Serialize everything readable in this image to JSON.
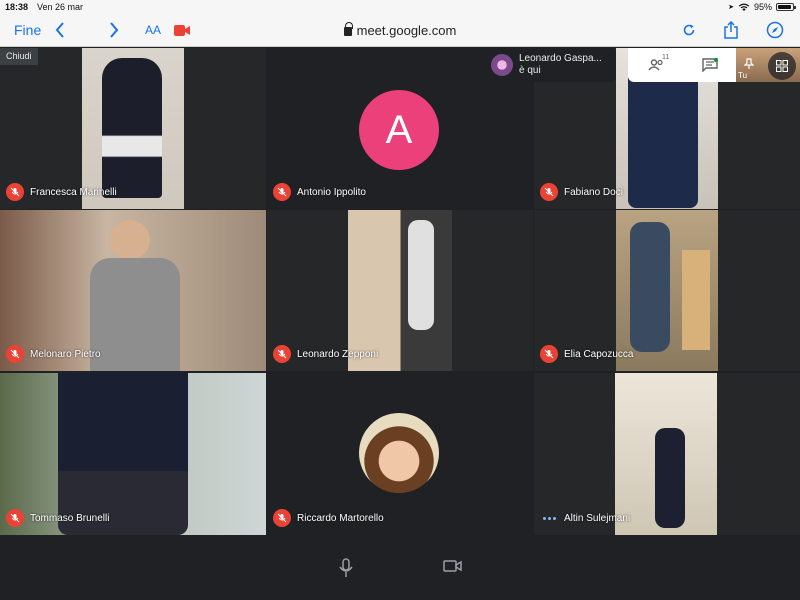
{
  "status_bar": {
    "time": "18:38",
    "date": "Ven 26 mar",
    "battery": "95%"
  },
  "browser": {
    "done_label": "Fine",
    "text_size_label": "AA",
    "url": "meet.google.com"
  },
  "meet": {
    "close_label": "Chiudi",
    "toast": {
      "name": "Leonardo Gaspa...",
      "message": "è qui"
    },
    "participant_count": "11",
    "self_label": "Tu",
    "participants": [
      {
        "name": "Francesca Marinelli",
        "muted": true
      },
      {
        "name": "Antonio Ippolito",
        "muted": true,
        "avatar_letter": "A",
        "avatar_color": "#ec407a"
      },
      {
        "name": "Fabiano Doci",
        "muted": true
      },
      {
        "name": "Melonaro Pietro",
        "muted": true
      },
      {
        "name": "Leonardo Zepponi",
        "muted": true
      },
      {
        "name": "Elia Capozucca",
        "muted": true
      },
      {
        "name": "Tommaso Brunelli",
        "muted": true
      },
      {
        "name": "Riccardo Martorello",
        "muted": true
      },
      {
        "name": "Altin Sulejmani",
        "muted": false
      }
    ]
  },
  "colors": {
    "accent": "#1a73e8",
    "mute_red": "#ea4335",
    "meet_bg": "#202124"
  }
}
